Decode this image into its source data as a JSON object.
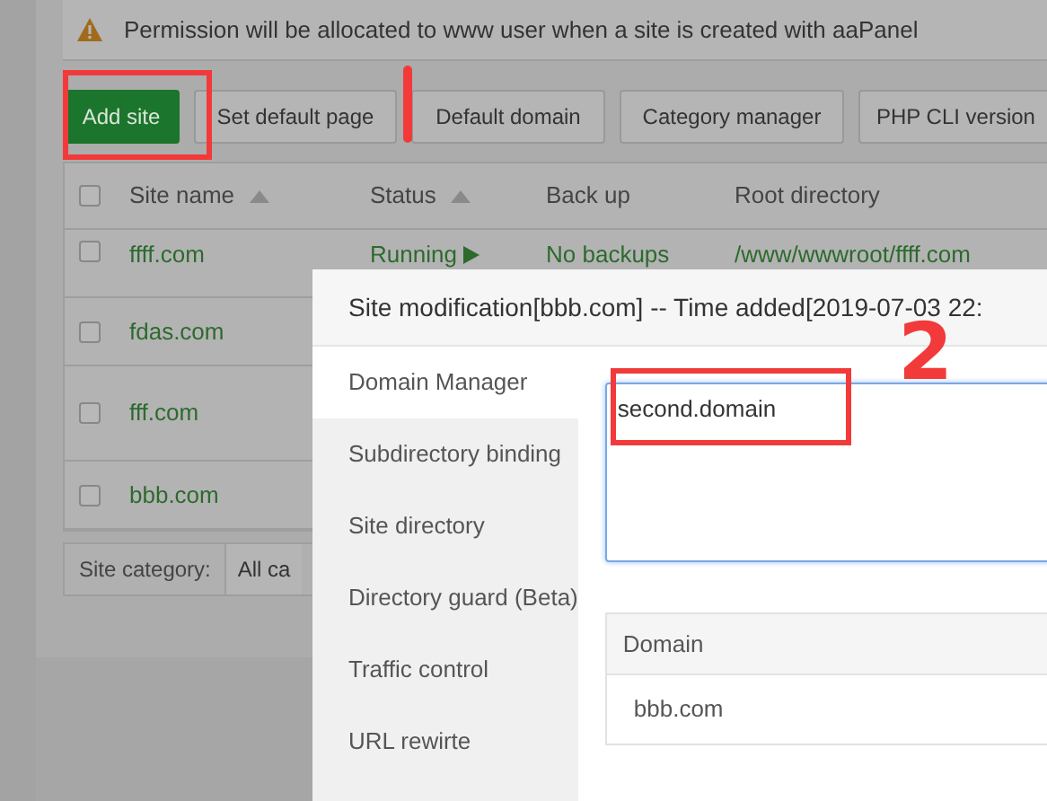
{
  "alert": {
    "text": "Permission will be allocated to www user when a site is created with aaPanel"
  },
  "toolbar": {
    "buttons": [
      {
        "label": "Add site",
        "kind": "primary"
      },
      {
        "label": "Set default page",
        "kind": "default"
      },
      {
        "label": "Default domain",
        "kind": "default"
      },
      {
        "label": "Category manager",
        "kind": "default"
      },
      {
        "label": "PHP CLI version",
        "kind": "default"
      }
    ]
  },
  "table": {
    "select_all": {
      "checked": false
    },
    "columns": [
      {
        "label": "Site name",
        "sortable": true
      },
      {
        "label": "Status",
        "sortable": true
      },
      {
        "label": "Back up",
        "sortable": false
      },
      {
        "label": "Root directory",
        "sortable": false
      }
    ],
    "rows": [
      {
        "checked": false,
        "site_name": "ffff.com",
        "status": "Running",
        "backup": "No backups",
        "root_directory": "/www/wwwroot/ffff.com"
      },
      {
        "checked": false,
        "site_name": "fdas.com"
      },
      {
        "checked": false,
        "site_name": "fff.com"
      },
      {
        "checked": false,
        "site_name": "bbb.com"
      }
    ]
  },
  "site_category": {
    "label": "Site category:",
    "value": "All ca"
  },
  "dialog": {
    "title": "Site modification[bbb.com] -- Time added[2019-07-03 22:",
    "menu": [
      {
        "label": "Domain Manager",
        "selected": true
      },
      {
        "label": "Subdirectory binding",
        "selected": false
      },
      {
        "label": "Site directory",
        "selected": false
      },
      {
        "label": "Directory guard (Beta)",
        "selected": false
      },
      {
        "label": "Traffic control",
        "selected": false
      },
      {
        "label": "URL rewirte",
        "selected": false
      }
    ],
    "domain_input": {
      "value": "second.domain"
    },
    "domain_table": {
      "columns": [
        "Domain"
      ],
      "rows": [
        "bbb.com"
      ]
    }
  },
  "annotations": [
    {
      "kind": "box"
    },
    {
      "kind": "stroke"
    },
    {
      "kind": "box"
    },
    {
      "kind": "number",
      "text": "2"
    }
  ]
}
